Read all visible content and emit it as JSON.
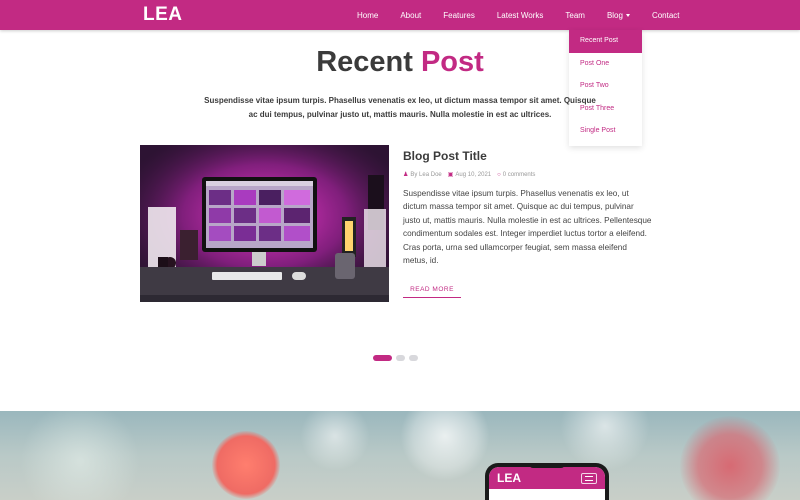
{
  "navbar": {
    "brand": "LEA",
    "items": [
      {
        "label": "Home"
      },
      {
        "label": "About"
      },
      {
        "label": "Features"
      },
      {
        "label": "Latest Works"
      },
      {
        "label": "Team"
      },
      {
        "label": "Blog"
      },
      {
        "label": "Contact"
      }
    ]
  },
  "dropdown": {
    "items": [
      {
        "label": "Recent Post",
        "active": true
      },
      {
        "label": "Post One"
      },
      {
        "label": "Post Two"
      },
      {
        "label": "Post Three"
      },
      {
        "label": "Single Post"
      }
    ]
  },
  "section": {
    "title_main": "Recent",
    "title_accent": "Post",
    "description": "Suspendisse vitae ipsum turpis. Phasellus venenatis ex leo, ut dictum massa tempor sit amet. Quisque ac dui tempus, pulvinar justo ut, mattis mauris. Nulla molestie in est ac ultrices."
  },
  "post": {
    "title": "Blog Post Title",
    "author": "By Lea Doe",
    "date": "Aug 10, 2021",
    "comments": "0 comments",
    "body": "Suspendisse vitae ipsum turpis. Phasellus venenatis ex leo, ut dictum massa tempor sit amet. Quisque ac dui tempus, pulvinar justo ut, mattis mauris. Nulla molestie in est ac ultrices. Pellentesque condimentum sodales est. Integer imperdiet luctus tortor a eleifend. Cras porta, urna sed ullamcorper feugiat, sem massa eleifend metus, id.",
    "read_more": "READ MORE"
  },
  "carousel": {
    "active_index": 0,
    "count": 3
  },
  "hero": {
    "phone_brand": "LEA"
  },
  "colors": {
    "primary": "#c22a83",
    "heading": "#3b3b3b",
    "text": "#444444",
    "dot_inactive": "#d8d8dc"
  },
  "icons": {
    "author": "user-icon",
    "date": "calendar-icon",
    "comments": "comment-icon",
    "dropdown": "caret-down-icon",
    "phone_menu": "hamburger-icon"
  }
}
